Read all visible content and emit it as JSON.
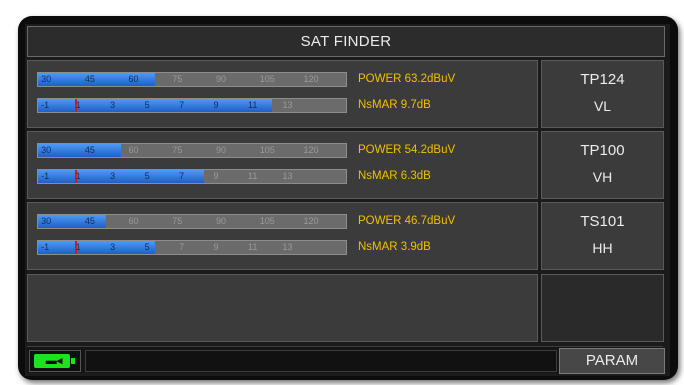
{
  "title": "SAT FINDER",
  "power_scale": [
    "30",
    "45",
    "60",
    "75",
    "90",
    "105",
    "120"
  ],
  "mer_scale": [
    "-1",
    "1",
    "3",
    "5",
    "7",
    "9",
    "11",
    "13"
  ],
  "rows": [
    {
      "power": "POWER  63.2dBuV",
      "nsmar": "NsMAR 9.7dB",
      "transponder": "TP124",
      "polarization": "VL",
      "power_level": 0.38,
      "mer_level": 0.76,
      "mer_marker_level": 0.12
    },
    {
      "power": "POWER  54.2dBuV",
      "nsmar": "NsMAR 6.3dB",
      "transponder": "TP100",
      "polarization": "VH",
      "power_level": 0.27,
      "mer_level": 0.54,
      "mer_marker_level": 0.12
    },
    {
      "power": "POWER  46.7dBuV",
      "nsmar": "NsMAR 3.9dB",
      "transponder": "TS101",
      "polarization": "HH",
      "power_level": 0.22,
      "mer_level": 0.38,
      "mer_marker_level": 0.12
    }
  ],
  "status": {
    "battery_icon": "battery-charging-icon",
    "battery_color": "#1de21d",
    "param_label": "PARAM"
  }
}
